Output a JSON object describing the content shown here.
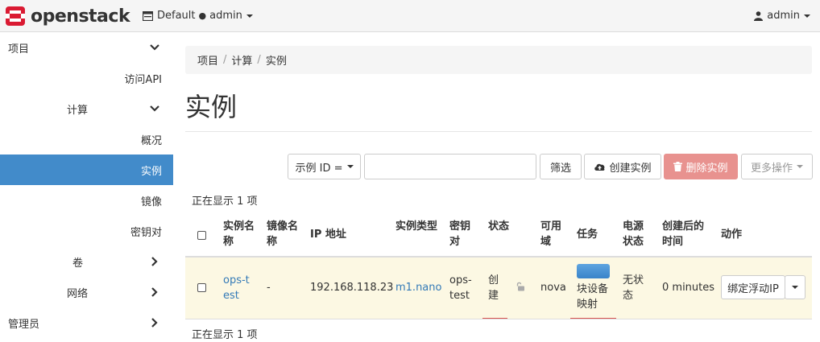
{
  "brand": {
    "name": "openstack",
    "color": "#da1a32"
  },
  "header": {
    "domain": "Default",
    "project": "admin",
    "user": "admin"
  },
  "sidebar": {
    "items": [
      {
        "label": "项目",
        "chevron": "down"
      },
      {
        "label": "访问API"
      },
      {
        "label": "计算",
        "chevron": "down"
      },
      {
        "label": "概况"
      },
      {
        "label": "实例",
        "active": true
      },
      {
        "label": "镜像"
      },
      {
        "label": "密钥对"
      },
      {
        "label": "卷",
        "chevron": "right"
      },
      {
        "label": "网络",
        "chevron": "right"
      },
      {
        "label": "管理员",
        "chevron": "right"
      }
    ]
  },
  "breadcrumb": [
    "项目",
    "计算",
    "实例"
  ],
  "page_title": "实例",
  "toolbar": {
    "filter_select": "示例 ID =",
    "filter_value": "",
    "filter_button": "筛选",
    "create_button": "创建实例",
    "delete_button": "删除实例",
    "more_button": "更多操作"
  },
  "count_text": "正在显示 1 项",
  "table": {
    "headers": [
      "实例名称",
      "镜像名称",
      "IP 地址",
      "实例类型",
      "密钥对",
      "状态",
      "可用域",
      "任务",
      "电源状态",
      "创建后的时间",
      "动作"
    ],
    "row": {
      "name": "ops-test",
      "image": "-",
      "ip": "192.168.118.23",
      "flavor": "m1.nano",
      "keypair": "ops-test",
      "status": "创建",
      "zone": "nova",
      "task": "块设备映射",
      "power": "无状态",
      "age": "0 minutes",
      "action": "绑定浮动IP"
    }
  },
  "colors": {
    "accent": "#428bca",
    "danger": "#e8928f",
    "row_highlight": "#fcf8e3"
  }
}
